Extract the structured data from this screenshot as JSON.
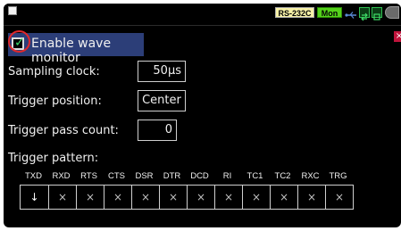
{
  "status_bar": {
    "interface": "RS-232C",
    "mode": "Mon",
    "icons": [
      "menu-icon",
      "usb-icon",
      "network-icon",
      "sd-card-icon",
      "power-icon"
    ]
  },
  "close_label": "×",
  "enable": {
    "label": "Enable wave monitor",
    "checked": true
  },
  "settings": {
    "sampling_clock_label": "Sampling clock:",
    "sampling_clock_value": "50μs",
    "trigger_position_label": "Trigger position:",
    "trigger_position_value": "Center",
    "trigger_pass_count_label": "Trigger pass count:",
    "trigger_pass_count_value": "0",
    "trigger_pattern_label": "Trigger pattern:"
  },
  "pattern": {
    "signals": [
      "TXD",
      "RXD",
      "RTS",
      "CTS",
      "DSR",
      "DTR",
      "DCD",
      "RI",
      "TC1",
      "TC2",
      "RXC",
      "TRG"
    ],
    "values": [
      "↓",
      "×",
      "×",
      "×",
      "×",
      "×",
      "×",
      "×",
      "×",
      "×",
      "×",
      "×"
    ]
  },
  "colors": {
    "background": "#000000",
    "selected_row": "#2c3e78",
    "mon_badge": "#55d21b",
    "rs_badge": "#f7f1a8",
    "close": "#c0143c",
    "check": "#3ed66a",
    "highlight_ring": "#e0282b"
  }
}
